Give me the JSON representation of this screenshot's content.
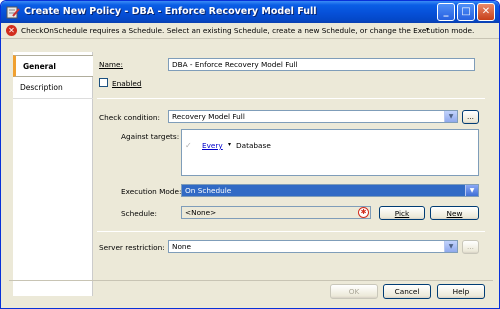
{
  "window": {
    "title": "Create New Policy  - DBA - Enforce Recovery Model Full",
    "controls": {
      "minimize": "_",
      "maximize": "□",
      "close": "✕"
    }
  },
  "message_bar": {
    "text": "CheckOnSchedule requires a Schedule. Select an existing Schedule, create a new Schedule, or change the Execution mode.",
    "dropdown_glyph": "▾"
  },
  "tabs": [
    {
      "label": "General",
      "active": true
    },
    {
      "label": "Description",
      "active": false
    }
  ],
  "form": {
    "name_label": "Name:",
    "name_value": "DBA - Enforce Recovery Model Full",
    "enabled_label": "Enabled",
    "enabled_checked": false,
    "check_condition_label": "Check condition:",
    "check_condition_value": "Recovery Model Full",
    "ellipsis_label": "...",
    "against_targets_label": "Against targets:",
    "target_every": "Every",
    "target_database": "Database",
    "execution_mode_label": "Execution Mode:",
    "execution_mode_value": "On Schedule",
    "schedule_label": "Schedule:",
    "schedule_value": "<None>",
    "pick_label": "Pick",
    "new_label": "New",
    "server_restriction_label": "Server restriction:",
    "server_restriction_value": "None"
  },
  "footer": {
    "ok_label": "OK",
    "cancel_label": "Cancel",
    "help_label": "Help"
  },
  "colors": {
    "titlebar": "#0650d8",
    "error": "#d22d1e",
    "selection": "#316ac5",
    "link": "#0000cc"
  }
}
